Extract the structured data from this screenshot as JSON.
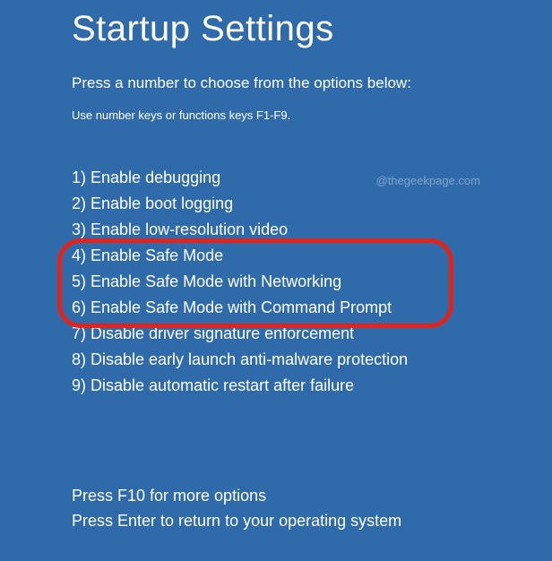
{
  "title": "Startup Settings",
  "subtitle": "Press a number to choose from the options below:",
  "hint": "Use number keys or functions keys F1-F9.",
  "watermark": "@thegeekpage.com",
  "options": [
    {
      "n": 1,
      "label": "Enable debugging"
    },
    {
      "n": 2,
      "label": "Enable boot logging"
    },
    {
      "n": 3,
      "label": "Enable low-resolution video"
    },
    {
      "n": 4,
      "label": "Enable Safe Mode"
    },
    {
      "n": 5,
      "label": "Enable Safe Mode with Networking"
    },
    {
      "n": 6,
      "label": "Enable Safe Mode with Command Prompt"
    },
    {
      "n": 7,
      "label": "Disable driver signature enforcement"
    },
    {
      "n": 8,
      "label": "Disable early launch anti-malware protection"
    },
    {
      "n": 9,
      "label": "Disable automatic restart after failure"
    }
  ],
  "footer": {
    "more": "Press F10 for more options",
    "return": "Press Enter to return to your operating system"
  },
  "highlight": {
    "start": 4,
    "end": 6
  },
  "colors": {
    "bg": "#2f6bab",
    "text": "#ffffff",
    "ring": "#e2231a"
  }
}
